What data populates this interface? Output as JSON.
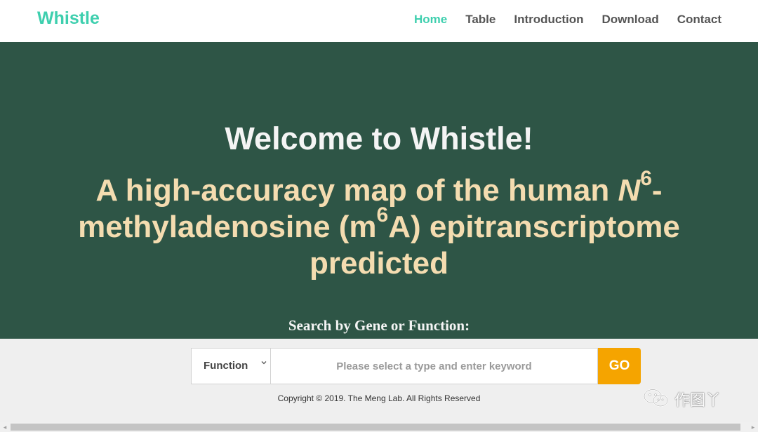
{
  "brand": "Whistle",
  "nav": {
    "items": [
      {
        "label": "Home",
        "active": true
      },
      {
        "label": "Table",
        "active": false
      },
      {
        "label": "Introduction",
        "active": false
      },
      {
        "label": "Download",
        "active": false
      },
      {
        "label": "Contact",
        "active": false
      }
    ]
  },
  "hero": {
    "title": "Welcome to Whistle!",
    "subtitle_part1": "A high-accuracy map of the human ",
    "subtitle_n": "N",
    "subtitle_sup1": "6",
    "subtitle_part2": "-methyladenosine (m",
    "subtitle_sup2": "6",
    "subtitle_part3": "A) epitranscriptome predicted"
  },
  "search": {
    "heading": "Search by Gene or Function:",
    "type_selected": "Function",
    "placeholder": "Please select a type and enter keyword",
    "go_label": "GO"
  },
  "footer": {
    "copyright": "Copyright © 2019. The Meng Lab. All Rights Reserved"
  },
  "watermark": {
    "text": "作图丫",
    "icon": "wechat-icon"
  },
  "scrollbar": {
    "left_arrow": "◂",
    "right_arrow": "▸"
  },
  "colors": {
    "brand": "#3ecfae",
    "hero_bg": "#2e5546",
    "subtitle": "#f4dcb0",
    "go_button": "#f5a400"
  }
}
